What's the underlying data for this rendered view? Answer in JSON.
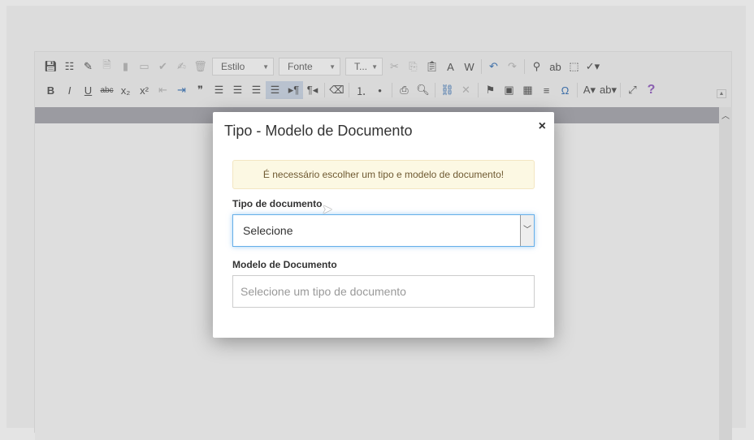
{
  "toolbar": {
    "row1": [
      {
        "n": "save-icon",
        "g": "💾︎",
        "t": "btn"
      },
      {
        "n": "template-icon",
        "g": "☷",
        "t": "btn"
      },
      {
        "n": "brush-icon",
        "g": "✎",
        "t": "btn"
      },
      {
        "n": "preview-doc-icon",
        "g": "🗎︎",
        "t": "dis"
      },
      {
        "n": "bookmark-icon",
        "g": "▮",
        "t": "dis"
      },
      {
        "n": "book-icon",
        "g": "▭",
        "t": "dis"
      },
      {
        "n": "validate-doc-icon",
        "g": "✔",
        "t": "dis"
      },
      {
        "n": "sign-icon",
        "g": "✍︎",
        "t": "dis"
      },
      {
        "n": "trash-icon",
        "g": "🗑︎",
        "t": "dis"
      },
      {
        "t": "combo",
        "n": "style-combo",
        "label": "Estilo",
        "w": 76
      },
      {
        "t": "combo",
        "n": "font-combo",
        "label": "Fonte",
        "w": 76
      },
      {
        "t": "combo",
        "n": "size-combo",
        "label": "T...",
        "w": 46
      },
      {
        "n": "cut-icon",
        "g": "✂",
        "t": "dis"
      },
      {
        "n": "copy-icon",
        "g": "⎘",
        "t": "dis"
      },
      {
        "n": "paste-icon",
        "g": "📋︎",
        "t": "btn"
      },
      {
        "n": "paste-text-icon",
        "g": "A",
        "t": "btn"
      },
      {
        "n": "paste-word-icon",
        "g": "W",
        "t": "btn"
      },
      {
        "t": "sep"
      },
      {
        "n": "undo-icon",
        "g": "↶",
        "t": "btn"
      },
      {
        "n": "redo-icon",
        "g": "↷",
        "t": "dis"
      },
      {
        "t": "sep"
      },
      {
        "n": "find-icon",
        "g": "⚲",
        "t": "btn"
      },
      {
        "n": "replace-icon",
        "g": "ab",
        "t": "btn"
      },
      {
        "n": "select-all-icon",
        "g": "⬚",
        "t": "btn"
      },
      {
        "n": "spellcheck-icon",
        "g": "✓▾",
        "t": "btn"
      }
    ],
    "row2": [
      {
        "n": "bold-icon",
        "g": "B",
        "t": "btn"
      },
      {
        "n": "italic-icon",
        "g": "I",
        "t": "btn"
      },
      {
        "n": "underline-icon",
        "g": "U",
        "t": "btn"
      },
      {
        "n": "strikethrough-icon",
        "g": "abc",
        "t": "btn"
      },
      {
        "n": "subscript-icon",
        "g": "x₂",
        "t": "btn"
      },
      {
        "n": "superscript-icon",
        "g": "x²",
        "t": "btn"
      },
      {
        "n": "outdent-icon",
        "g": "⇤",
        "t": "dis"
      },
      {
        "n": "indent-icon",
        "g": "⇥",
        "t": "btn"
      },
      {
        "n": "blockquote-icon",
        "g": "❞",
        "t": "btn"
      },
      {
        "n": "align-left-icon",
        "g": "☰",
        "t": "btn"
      },
      {
        "n": "align-center-icon",
        "g": "☰",
        "t": "btn"
      },
      {
        "n": "align-right-icon",
        "g": "☰",
        "t": "btn"
      },
      {
        "n": "justify-icon",
        "g": "☰",
        "t": "on"
      },
      {
        "n": "ltr-icon",
        "g": "▸¶",
        "t": "on"
      },
      {
        "n": "rtl-icon",
        "g": "¶◂",
        "t": "btn"
      },
      {
        "t": "sep"
      },
      {
        "n": "remove-format-icon",
        "g": "⌫",
        "t": "btn"
      },
      {
        "t": "sep"
      },
      {
        "n": "numbered-list-icon",
        "g": "⒈",
        "t": "btn"
      },
      {
        "n": "bulleted-list-icon",
        "g": "•",
        "t": "btn"
      },
      {
        "t": "sep"
      },
      {
        "n": "print-icon",
        "g": "⎙",
        "t": "btn"
      },
      {
        "n": "preview-icon",
        "g": "🔍︎",
        "t": "btn"
      },
      {
        "t": "sep"
      },
      {
        "n": "link-icon",
        "g": "⛓",
        "t": "btn"
      },
      {
        "n": "unlink-icon",
        "g": "✕",
        "t": "dis"
      },
      {
        "t": "sep"
      },
      {
        "n": "anchor-icon",
        "g": "⚑",
        "t": "btn"
      },
      {
        "n": "image-icon",
        "g": "▣",
        "t": "btn"
      },
      {
        "n": "table-icon",
        "g": "▦",
        "t": "btn"
      },
      {
        "n": "horizontal-line-icon",
        "g": "≡",
        "t": "btn"
      },
      {
        "n": "special-char-icon",
        "g": "Ω",
        "t": "btn"
      },
      {
        "t": "sep"
      },
      {
        "n": "text-color-icon",
        "g": "A▾",
        "t": "btn"
      },
      {
        "n": "bg-color-icon",
        "g": "ab▾",
        "t": "btn"
      },
      {
        "t": "sep"
      },
      {
        "n": "maximize-icon",
        "g": "⤢",
        "t": "btn"
      },
      {
        "n": "help-icon",
        "g": "?",
        "t": "btn"
      }
    ]
  },
  "modal": {
    "title": "Tipo - Modelo de Documento",
    "close": "×",
    "alert": "É necessário escolher um tipo e modelo de documento!",
    "type_label": "Tipo de documento",
    "type_value": "Selecione",
    "model_label": "Modelo de Documento",
    "model_placeholder": "Selecione um tipo de documento"
  },
  "colors": {
    "alert_bg": "#fcf8e3",
    "focus": "#66afe9"
  }
}
